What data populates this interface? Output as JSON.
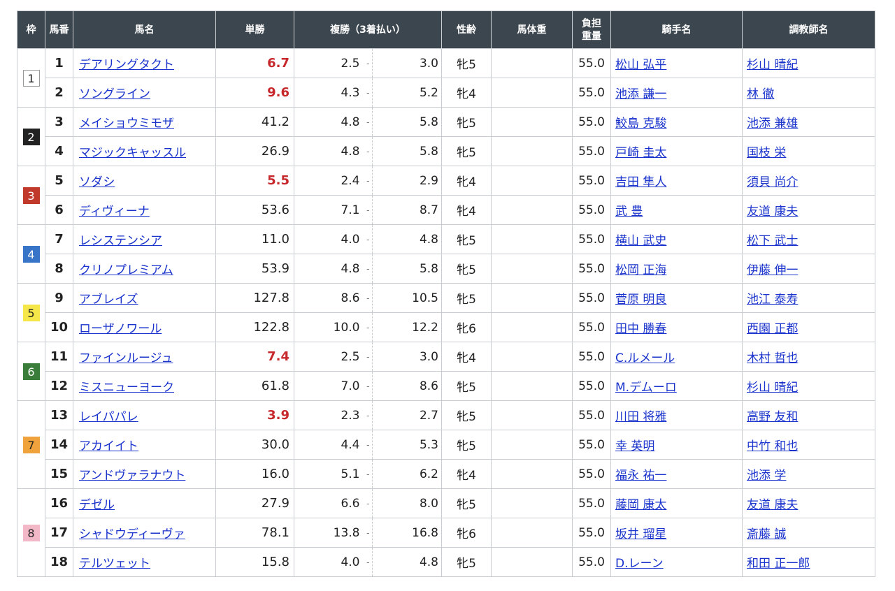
{
  "headers": {
    "waku": "枠",
    "umaban": "馬番",
    "name": "馬名",
    "tansho": "単勝",
    "fukusho": "複勝（3着払い）",
    "sexage": "性齢",
    "bodyweight": "馬体重",
    "weight_line1": "負担",
    "weight_line2": "重量",
    "jockey": "騎手名",
    "trainer": "調教師名"
  },
  "waku_colors": {
    "1": {
      "bg": "#ffffff",
      "fg": "#222222",
      "border": "#999999"
    },
    "2": {
      "bg": "#222222",
      "fg": "#ffffff",
      "border": "#222222"
    },
    "3": {
      "bg": "#c0392b",
      "fg": "#ffffff",
      "border": "#c0392b"
    },
    "4": {
      "bg": "#3874c8",
      "fg": "#ffffff",
      "border": "#3874c8"
    },
    "5": {
      "bg": "#f5e64a",
      "fg": "#222222",
      "border": "#f5e64a"
    },
    "6": {
      "bg": "#3a7d3a",
      "fg": "#ffffff",
      "border": "#3a7d3a"
    },
    "7": {
      "bg": "#f0a23c",
      "fg": "#222222",
      "border": "#f0a23c"
    },
    "8": {
      "bg": "#f3b8c8",
      "fg": "#222222",
      "border": "#f3b8c8"
    }
  },
  "favorite_color": "#c6282b",
  "link_color": "#1a33cc",
  "rows": [
    {
      "waku": "1",
      "umaban": "1",
      "name": "デアリングタクト",
      "tansho": "6.7",
      "fav": true,
      "fmin": "2.5",
      "fmax": "3.0",
      "sexage": "牝5",
      "bodyweight": "",
      "weight": "55.0",
      "jockey": "松山 弘平",
      "trainer": "杉山 晴紀"
    },
    {
      "waku": "1",
      "umaban": "2",
      "name": "ソングライン",
      "tansho": "9.6",
      "fav": true,
      "fmin": "4.3",
      "fmax": "5.2",
      "sexage": "牝4",
      "bodyweight": "",
      "weight": "55.0",
      "jockey": "池添 謙一",
      "trainer": "林 徹"
    },
    {
      "waku": "2",
      "umaban": "3",
      "name": "メイショウミモザ",
      "tansho": "41.2",
      "fav": false,
      "fmin": "4.8",
      "fmax": "5.8",
      "sexage": "牝5",
      "bodyweight": "",
      "weight": "55.0",
      "jockey": "鮫島 克駿",
      "trainer": "池添 兼雄"
    },
    {
      "waku": "2",
      "umaban": "4",
      "name": "マジックキャッスル",
      "tansho": "26.9",
      "fav": false,
      "fmin": "4.8",
      "fmax": "5.8",
      "sexage": "牝5",
      "bodyweight": "",
      "weight": "55.0",
      "jockey": "戸崎 圭太",
      "trainer": "国枝 栄"
    },
    {
      "waku": "3",
      "umaban": "5",
      "name": "ソダシ",
      "tansho": "5.5",
      "fav": true,
      "fmin": "2.4",
      "fmax": "2.9",
      "sexage": "牝4",
      "bodyweight": "",
      "weight": "55.0",
      "jockey": "吉田 隼人",
      "trainer": "須貝 尚介"
    },
    {
      "waku": "3",
      "umaban": "6",
      "name": "ディヴィーナ",
      "tansho": "53.6",
      "fav": false,
      "fmin": "7.1",
      "fmax": "8.7",
      "sexage": "牝4",
      "bodyweight": "",
      "weight": "55.0",
      "jockey": "武 豊",
      "trainer": "友道 康夫"
    },
    {
      "waku": "4",
      "umaban": "7",
      "name": "レシステンシア",
      "tansho": "11.0",
      "fav": false,
      "fmin": "4.0",
      "fmax": "4.8",
      "sexage": "牝5",
      "bodyweight": "",
      "weight": "55.0",
      "jockey": "横山 武史",
      "trainer": "松下 武士"
    },
    {
      "waku": "4",
      "umaban": "8",
      "name": "クリノプレミアム",
      "tansho": "53.9",
      "fav": false,
      "fmin": "4.8",
      "fmax": "5.8",
      "sexage": "牝5",
      "bodyweight": "",
      "weight": "55.0",
      "jockey": "松岡 正海",
      "trainer": "伊藤 伸一"
    },
    {
      "waku": "5",
      "umaban": "9",
      "name": "アブレイズ",
      "tansho": "127.8",
      "fav": false,
      "fmin": "8.6",
      "fmax": "10.5",
      "sexage": "牝5",
      "bodyweight": "",
      "weight": "55.0",
      "jockey": "菅原 明良",
      "trainer": "池江 泰寿"
    },
    {
      "waku": "5",
      "umaban": "10",
      "name": "ローザノワール",
      "tansho": "122.8",
      "fav": false,
      "fmin": "10.0",
      "fmax": "12.2",
      "sexage": "牝6",
      "bodyweight": "",
      "weight": "55.0",
      "jockey": "田中 勝春",
      "trainer": "西園 正都"
    },
    {
      "waku": "6",
      "umaban": "11",
      "name": "ファインルージュ",
      "tansho": "7.4",
      "fav": true,
      "fmin": "2.5",
      "fmax": "3.0",
      "sexage": "牝4",
      "bodyweight": "",
      "weight": "55.0",
      "jockey": "C.ルメール",
      "trainer": "木村 哲也"
    },
    {
      "waku": "6",
      "umaban": "12",
      "name": "ミスニューヨーク",
      "tansho": "61.8",
      "fav": false,
      "fmin": "7.0",
      "fmax": "8.6",
      "sexage": "牝5",
      "bodyweight": "",
      "weight": "55.0",
      "jockey": "M.デムーロ",
      "trainer": "杉山 晴紀"
    },
    {
      "waku": "7",
      "umaban": "13",
      "name": "レイパパレ",
      "tansho": "3.9",
      "fav": true,
      "fmin": "2.3",
      "fmax": "2.7",
      "sexage": "牝5",
      "bodyweight": "",
      "weight": "55.0",
      "jockey": "川田 将雅",
      "trainer": "高野 友和"
    },
    {
      "waku": "7",
      "umaban": "14",
      "name": "アカイイト",
      "tansho": "30.0",
      "fav": false,
      "fmin": "4.4",
      "fmax": "5.3",
      "sexage": "牝5",
      "bodyweight": "",
      "weight": "55.0",
      "jockey": "幸 英明",
      "trainer": "中竹 和也"
    },
    {
      "waku": "7",
      "umaban": "15",
      "name": "アンドヴァラナウト",
      "tansho": "16.0",
      "fav": false,
      "fmin": "5.1",
      "fmax": "6.2",
      "sexage": "牝4",
      "bodyweight": "",
      "weight": "55.0",
      "jockey": "福永 祐一",
      "trainer": "池添 学"
    },
    {
      "waku": "8",
      "umaban": "16",
      "name": "デゼル",
      "tansho": "27.9",
      "fav": false,
      "fmin": "6.6",
      "fmax": "8.0",
      "sexage": "牝5",
      "bodyweight": "",
      "weight": "55.0",
      "jockey": "藤岡 康太",
      "trainer": "友道 康夫"
    },
    {
      "waku": "8",
      "umaban": "17",
      "name": "シャドウディーヴァ",
      "tansho": "78.1",
      "fav": false,
      "fmin": "13.8",
      "fmax": "16.8",
      "sexage": "牝6",
      "bodyweight": "",
      "weight": "55.0",
      "jockey": "坂井 瑠星",
      "trainer": "斎藤 誠"
    },
    {
      "waku": "8",
      "umaban": "18",
      "name": "テルツェット",
      "tansho": "15.8",
      "fav": false,
      "fmin": "4.0",
      "fmax": "4.8",
      "sexage": "牝5",
      "bodyweight": "",
      "weight": "55.0",
      "jockey": "D.レーン",
      "trainer": "和田 正一郎"
    }
  ]
}
